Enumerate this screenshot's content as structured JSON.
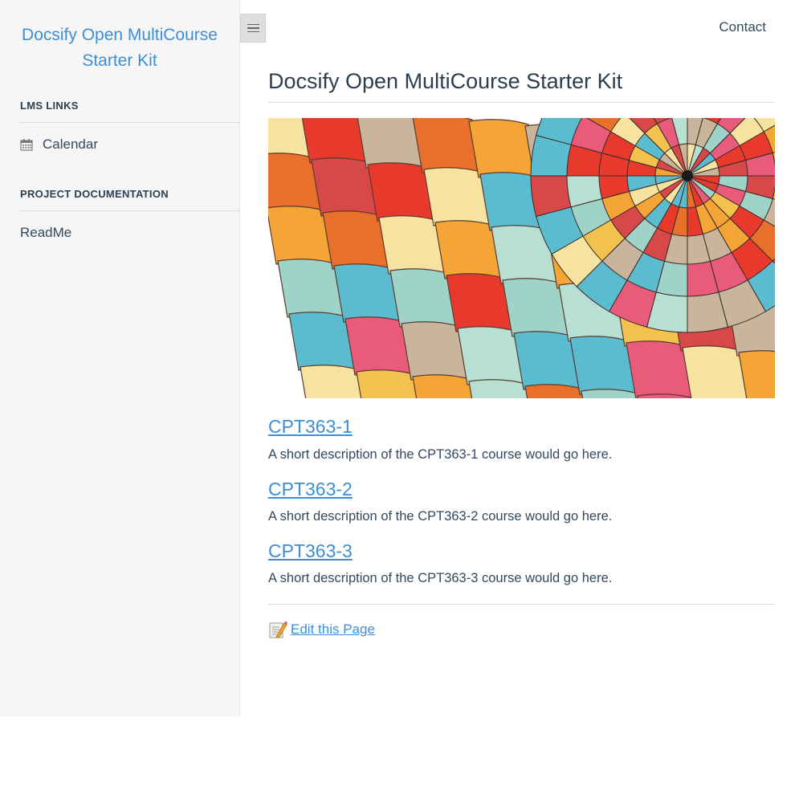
{
  "sidebar": {
    "app_name": "Docsify Open MultiCourse Starter Kit",
    "sections": [
      {
        "heading": "LMS Links",
        "items": [
          {
            "label": "Calendar",
            "icon": "calendar-icon"
          }
        ]
      },
      {
        "heading": "Project Documentation",
        "items": [
          {
            "label": "ReadMe"
          }
        ]
      }
    ]
  },
  "nav": {
    "contact_label": "Contact",
    "toggle_icon": "hamburger-menu-icon"
  },
  "main": {
    "title": "Docsify Open MultiCourse Starter Kit",
    "hero_image": "colorful-hot-air-balloon-fabric",
    "courses": [
      {
        "name": "CPT363-1",
        "description": "A short description of the CPT363-1 course would go here."
      },
      {
        "name": "CPT363-2",
        "description": "A short description of the CPT363-2 course would go here."
      },
      {
        "name": "CPT363-3",
        "description": "A short description of the CPT363-3 course would go here."
      }
    ],
    "edit_label": "Edit this Page",
    "edit_icon": "memo-pencil-icon"
  },
  "colors": {
    "accent": "#3d8ed7",
    "sidebar_bg": "#f6f6f6",
    "text": "#34495e"
  }
}
